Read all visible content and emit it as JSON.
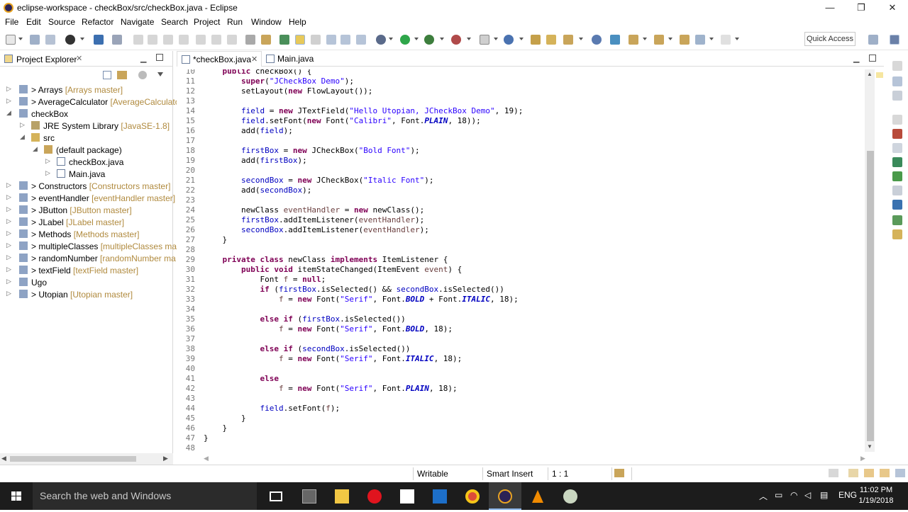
{
  "window": {
    "title": "eclipse-workspace - checkBox/src/checkBox.java - Eclipse",
    "controls": [
      "—",
      "❐",
      "✕"
    ]
  },
  "menu": [
    "File",
    "Edit",
    "Source",
    "Refactor",
    "Navigate",
    "Search",
    "Project",
    "Run",
    "Window",
    "Help"
  ],
  "toolbar": {
    "quick_access": "Quick Access"
  },
  "explorer": {
    "title": "Project Explorer",
    "close": "✕",
    "items": [
      {
        "name": "> Arrays",
        "repo": " [Arrays master]"
      },
      {
        "name": "> AverageCalculator",
        "repo": " [AverageCalculator"
      },
      {
        "name": "checkBox",
        "repo": ""
      },
      {
        "name": "JRE System Library",
        "repo": " [JavaSE-1.8]"
      },
      {
        "name": "src",
        "repo": ""
      },
      {
        "name": "(default package)",
        "repo": ""
      },
      {
        "name": "checkBox.java",
        "repo": ""
      },
      {
        "name": "Main.java",
        "repo": ""
      },
      {
        "name": "> Constructors",
        "repo": " [Constructors master]"
      },
      {
        "name": "> eventHandler",
        "repo": " [eventHandler master]"
      },
      {
        "name": "> JButton",
        "repo": " [JButton master]"
      },
      {
        "name": "> JLabel",
        "repo": " [JLabel master]"
      },
      {
        "name": "> Methods",
        "repo": " [Methods master]"
      },
      {
        "name": "> multipleClasses",
        "repo": " [multipleClasses mast"
      },
      {
        "name": "> randomNumber",
        "repo": " [randomNumber ma"
      },
      {
        "name": "> textField",
        "repo": " [textField master]"
      },
      {
        "name": "Ugo",
        "repo": ""
      },
      {
        "name": "> Utopian",
        "repo": " [Utopian master]"
      }
    ]
  },
  "editor": {
    "tabs": [
      {
        "label": "*checkBox.java",
        "close": "✕"
      },
      {
        "label": "Main.java",
        "close": ""
      }
    ],
    "lines": [
      {
        "n": "10",
        "t": "    public checkBox() {"
      },
      {
        "n": "11",
        "t": "        super(\"JCheckBox Demo\");"
      },
      {
        "n": "12",
        "t": "        setLayout(new FlowLayout());"
      },
      {
        "n": "13",
        "t": ""
      },
      {
        "n": "14",
        "t": "        field = new JTextField(\"Hello Utopian, JCheckBox Demo\", 19);"
      },
      {
        "n": "15",
        "t": "        field.setFont(new Font(\"Calibri\", Font.PLAIN, 18));"
      },
      {
        "n": "16",
        "t": "        add(field);"
      },
      {
        "n": "17",
        "t": ""
      },
      {
        "n": "18",
        "t": "        firstBox = new JCheckBox(\"Bold Font\");"
      },
      {
        "n": "19",
        "t": "        add(firstBox);"
      },
      {
        "n": "20",
        "t": ""
      },
      {
        "n": "21",
        "t": "        secondBox = new JCheckBox(\"Italic Font\");"
      },
      {
        "n": "22",
        "t": "        add(secondBox);"
      },
      {
        "n": "23",
        "t": ""
      },
      {
        "n": "24",
        "t": "        newClass eventHandler = new newClass();"
      },
      {
        "n": "25",
        "t": "        firstBox.addItemListener(eventHandler);"
      },
      {
        "n": "26",
        "t": "        secondBox.addItemListener(eventHandler);"
      },
      {
        "n": "27",
        "t": "    }"
      },
      {
        "n": "28",
        "t": ""
      },
      {
        "n": "29",
        "t": "    private class newClass implements ItemListener {"
      },
      {
        "n": "30",
        "t": "        public void itemStateChanged(ItemEvent event) {"
      },
      {
        "n": "31",
        "t": "            Font f = null;"
      },
      {
        "n": "32",
        "t": "            if (firstBox.isSelected() && secondBox.isSelected())"
      },
      {
        "n": "33",
        "t": "                f = new Font(\"Serif\", Font.BOLD + Font.ITALIC, 18);"
      },
      {
        "n": "34",
        "t": ""
      },
      {
        "n": "35",
        "t": "            else if (firstBox.isSelected())"
      },
      {
        "n": "36",
        "t": "                f = new Font(\"Serif\", Font.BOLD, 18);"
      },
      {
        "n": "37",
        "t": ""
      },
      {
        "n": "38",
        "t": "            else if (secondBox.isSelected())"
      },
      {
        "n": "39",
        "t": "                f = new Font(\"Serif\", Font.ITALIC, 18);"
      },
      {
        "n": "40",
        "t": ""
      },
      {
        "n": "41",
        "t": "            else"
      },
      {
        "n": "42",
        "t": "                f = new Font(\"Serif\", Font.PLAIN, 18);"
      },
      {
        "n": "43",
        "t": ""
      },
      {
        "n": "44",
        "t": "            field.setFont(f);"
      },
      {
        "n": "45",
        "t": "        }"
      },
      {
        "n": "46",
        "t": "    }"
      },
      {
        "n": "47",
        "t": "}"
      },
      {
        "n": "48",
        "t": ""
      }
    ]
  },
  "status": {
    "writable": "Writable",
    "insert_mode": "Smart Insert",
    "position": "1 : 1"
  },
  "taskbar": {
    "search_placeholder": "Search the web and Windows",
    "language": "ENG",
    "time": "11:02 PM",
    "date": "1/19/2018"
  },
  "colors": {
    "keyword": "#7f0055",
    "string": "#2a00ff",
    "field": "#0000c0",
    "repo_label": "#b08a3e",
    "taskbar": "#1c1c1c"
  }
}
